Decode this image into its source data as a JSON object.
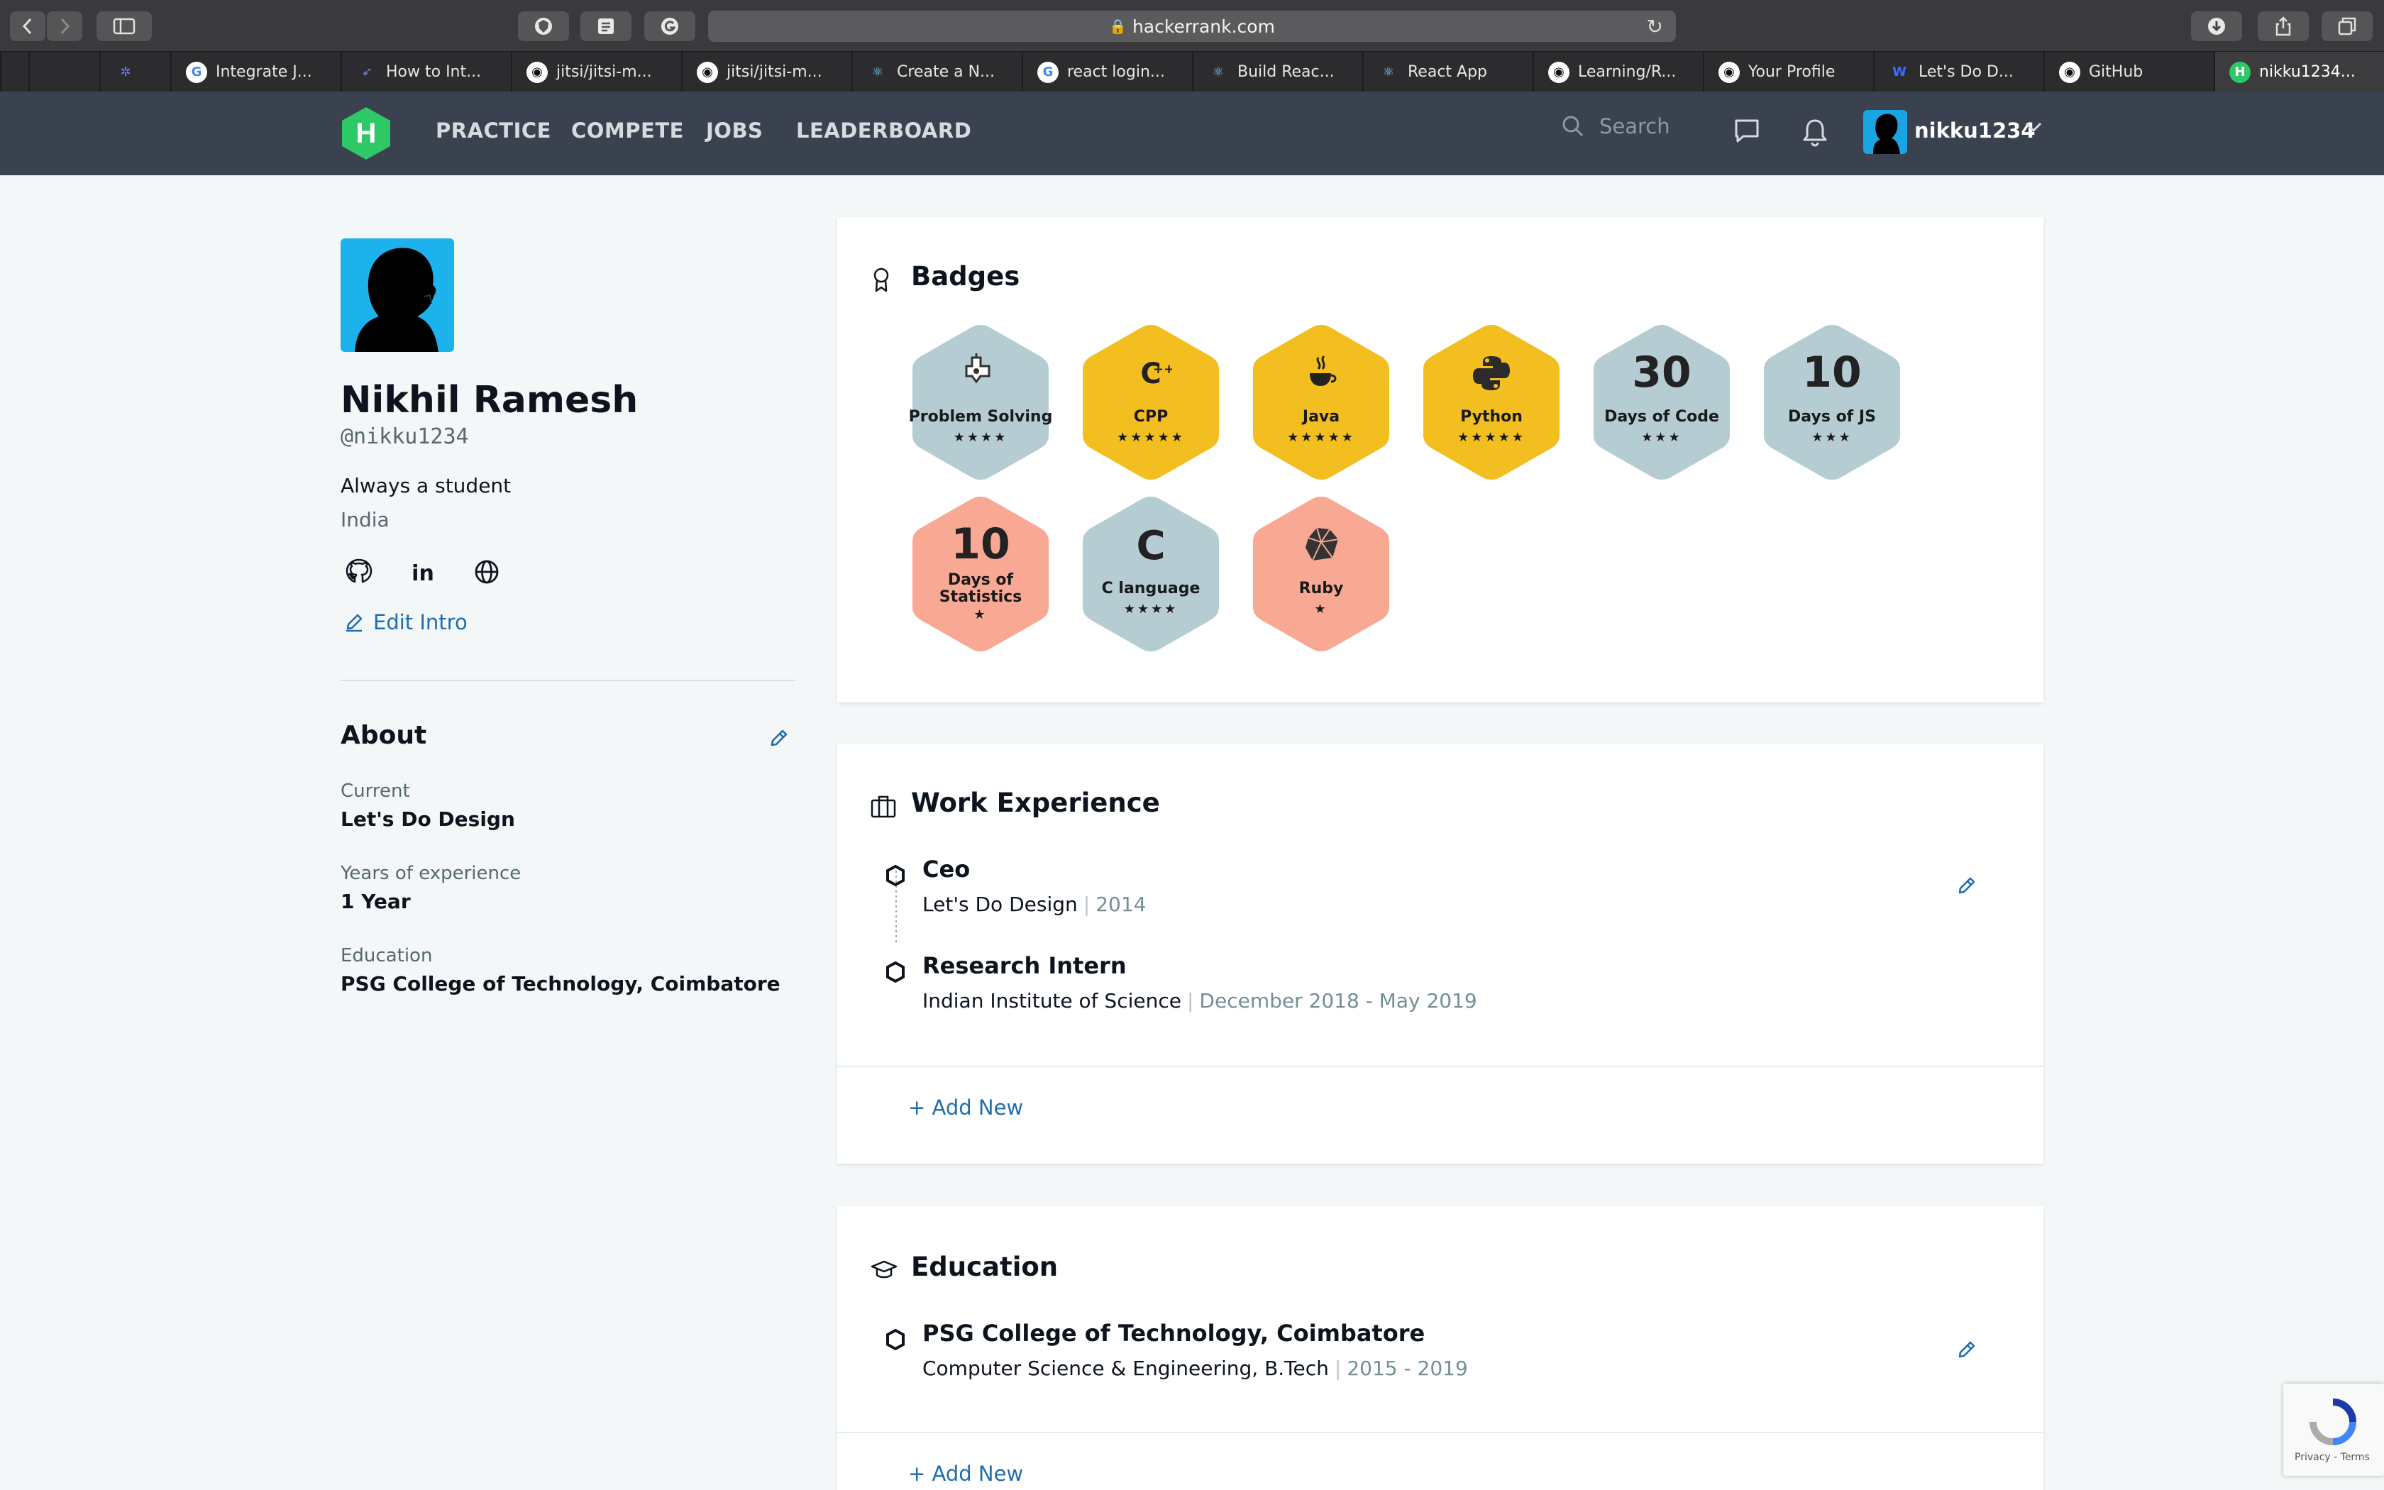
{
  "browser": {
    "url": "hackerrank.com",
    "tabs": [
      {
        "label": "",
        "favicon": "blank-icon"
      },
      {
        "label": "",
        "favicon": "blank-icon"
      },
      {
        "label": "",
        "favicon": "gear-icon"
      },
      {
        "label": "Integrate J...",
        "favicon": "google-icon"
      },
      {
        "label": "How to Int...",
        "favicon": "rocket-icon"
      },
      {
        "label": "jitsi/jitsi-m...",
        "favicon": "github-icon"
      },
      {
        "label": "jitsi/jitsi-m...",
        "favicon": "github-icon"
      },
      {
        "label": "Create a N...",
        "favicon": "react-icon"
      },
      {
        "label": "react login...",
        "favicon": "google-icon"
      },
      {
        "label": "Build Reac...",
        "favicon": "react-icon"
      },
      {
        "label": "React App",
        "favicon": "react-icon"
      },
      {
        "label": "Learning/R...",
        "favicon": "github-icon"
      },
      {
        "label": "Your Profile",
        "favicon": "github-icon"
      },
      {
        "label": "Let's Do D...",
        "favicon": "w-icon"
      },
      {
        "label": "GitHub",
        "favicon": "github-icon"
      },
      {
        "label": "nikku1234...",
        "favicon": "hackerrank-icon"
      }
    ]
  },
  "nav": {
    "logo_letter": "H",
    "links": [
      "PRACTICE",
      "COMPETE",
      "JOBS",
      "LEADERBOARD"
    ],
    "search_placeholder": "Search",
    "username": "nikku1234"
  },
  "profile": {
    "name": "Nikhil Ramesh",
    "handle": "@nikku1234",
    "bio": "Always a student",
    "country": "India",
    "edit_intro": "Edit Intro"
  },
  "about": {
    "title": "About",
    "current_label": "Current",
    "current_value": "Let's Do Design",
    "experience_label": "Years of experience",
    "experience_value": "1 Year",
    "education_label": "Education",
    "education_value": "PSG College of Technology, Coimbatore"
  },
  "badges": {
    "title": "Badges",
    "items": [
      {
        "label": "Problem Solving",
        "stars": "★★★★",
        "num": "",
        "color": "#b4ccd2",
        "icon": "problem-solving-icon"
      },
      {
        "label": "CPP",
        "stars": "★★★★★",
        "num": "",
        "color": "#f3be1f",
        "icon": "cpp-icon"
      },
      {
        "label": "Java",
        "stars": "★★★★★",
        "num": "",
        "color": "#f3be1f",
        "icon": "java-icon"
      },
      {
        "label": "Python",
        "stars": "★★★★★",
        "num": "",
        "color": "#f3be1f",
        "icon": "python-icon"
      },
      {
        "label": "Days of Code",
        "stars": "★★★",
        "num": "30",
        "color": "#b4ccd2",
        "icon": ""
      },
      {
        "label": "Days of JS",
        "stars": "★★★",
        "num": "10",
        "color": "#b4ccd2",
        "icon": ""
      },
      {
        "label": "Days of Statistics",
        "label_line1": "Days of",
        "label_line2": "Statistics",
        "stars": "★",
        "num": "10",
        "color": "#f8a893",
        "icon": ""
      },
      {
        "label": "C language",
        "stars": "★★★★",
        "num": "",
        "color": "#b4ccd2",
        "icon": "c-icon"
      },
      {
        "label": "Ruby",
        "stars": "★",
        "num": "",
        "color": "#f8a893",
        "icon": "ruby-icon"
      }
    ]
  },
  "work": {
    "title": "Work Experience",
    "items": [
      {
        "title": "Ceo",
        "org": "Let's Do Design",
        "date": "2014"
      },
      {
        "title": "Research Intern",
        "org": "Indian Institute of Science",
        "date": "December 2018 - May 2019"
      }
    ],
    "add_new": "+ Add New"
  },
  "education": {
    "title": "Education",
    "items": [
      {
        "title": "PSG College of Technology, Coimbatore",
        "org": "Computer Science & Engineering, B.Tech",
        "date": "2015 - 2019"
      }
    ],
    "add_new": "+ Add New"
  },
  "recaptcha": {
    "text": "Privacy - Terms"
  },
  "colors": {
    "nav": "#39424e",
    "brand_green": "#2ec866",
    "link_blue": "#1f6dae",
    "badge_gold": "#f3be1f",
    "badge_silver": "#b4ccd2",
    "badge_bronze": "#f8a893"
  }
}
